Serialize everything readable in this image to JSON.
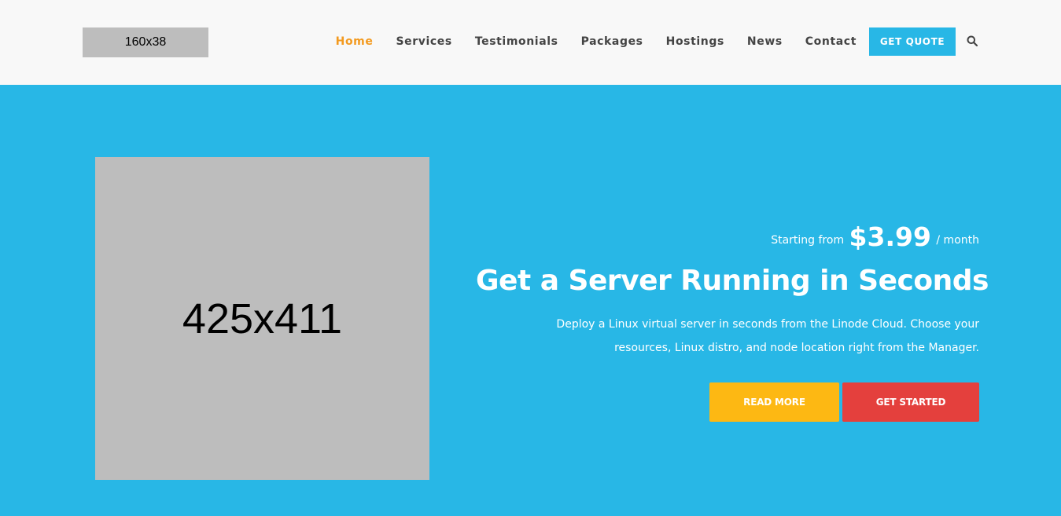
{
  "header": {
    "logo_text": "160x38",
    "nav": [
      {
        "label": "Home",
        "active": true
      },
      {
        "label": "Services",
        "active": false
      },
      {
        "label": "Testimonials",
        "active": false
      },
      {
        "label": "Packages",
        "active": false
      },
      {
        "label": "Hostings",
        "active": false
      },
      {
        "label": "News",
        "active": false
      },
      {
        "label": "Contact",
        "active": false
      }
    ],
    "quote_label": "GET QUOTE",
    "search_icon": "search-icon"
  },
  "hero": {
    "image_placeholder": "425x411",
    "price_prefix": "Starting from",
    "price": "$3.99",
    "price_suffix": "/ month",
    "title": "Get a Server Running in Seconds",
    "desc_line1": "Deploy a Linux virtual server in seconds from the Linode Cloud. Choose your",
    "desc_line2": "resources, Linux distro, and node location right from the Manager.",
    "read_more_label": "READ MORE",
    "get_started_label": "GET STARTED"
  },
  "colors": {
    "brand_blue": "#28b7e6",
    "active_nav": "#f39a1f",
    "read_more": "#fdb813",
    "get_started": "#e4403d"
  }
}
